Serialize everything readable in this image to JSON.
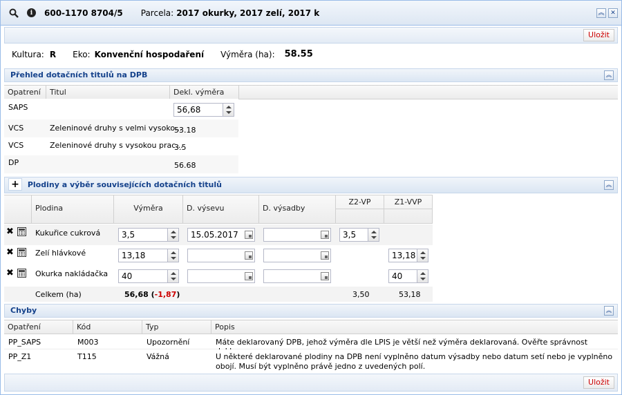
{
  "title": {
    "id": "600-1170 8704/5",
    "parcel_label": "Parcela:",
    "parcel_value": "2017 okurky, 2017 zelí, 2017 k"
  },
  "toolbar": {
    "save_label": "Uložit"
  },
  "info": {
    "culture_label": "Kultura:",
    "culture_value": "R",
    "eko_label": "Eko:",
    "eko_value": "Konvenční hospodaření",
    "area_label": "Výměra (ha):",
    "area_value": "58.55"
  },
  "overview": {
    "title": "Přehled dotačních titulů na DPB",
    "columns": [
      "Opatrení",
      "Titul",
      "Dekl. výměra"
    ],
    "rows": [
      {
        "measure": "SAPS",
        "title": "",
        "area": "56,68"
      },
      {
        "measure": "VCS",
        "title": "Zeleninové druhy s velmi vysoko...",
        "area": "53.18"
      },
      {
        "measure": "VCS",
        "title": "Zeleninové druhy s vysokou prac...",
        "area": "3.5"
      },
      {
        "measure": "DP",
        "title": "",
        "area": "56.68"
      }
    ]
  },
  "crops": {
    "title": "Plodiny a výběr souvisejících dotačních titulů",
    "columns": [
      "Plodina",
      "Výměra",
      "D. výsevu",
      "D. výsadby",
      "Z2-VP",
      "Z1-VVP"
    ],
    "rows": [
      {
        "crop": "Kukuřice cukrová",
        "area": "3,5",
        "sowing": "15.05.2017",
        "planting": "",
        "z2": "3,5",
        "z1": ""
      },
      {
        "crop": "Zelí hlávkové",
        "area": "13,18",
        "sowing": "",
        "planting": "",
        "z2": "",
        "z1": "13,18"
      },
      {
        "crop": "Okurka nakládačka",
        "area": "40",
        "sowing": "",
        "planting": "",
        "z2": "",
        "z1": "40"
      }
    ],
    "total": {
      "label": "Celkem (ha)",
      "area": "56,68",
      "diff": "-1,87",
      "z2": "3,50",
      "z1": "53,18"
    }
  },
  "errors": {
    "title": "Chyby",
    "columns": [
      "Opatření",
      "Kód",
      "Typ",
      "Popis"
    ],
    "rows": [
      {
        "measure": "PP_SAPS",
        "code": "M003",
        "type": "Upozornění",
        "desc": "Máte deklarovaný DPB, jehož výměra dle LPIS je větší než výměra deklarovaná. Ověřte správnost deklarace."
      },
      {
        "measure": "PP_Z1",
        "code": "T115",
        "type": "Vážná",
        "desc": "U některé deklarované plodiny na DPB není vyplněno datum výsadby nebo datum setí nebo je vyplněno obojí. Musí být vyplněno právě jedno z uvedených polí."
      }
    ]
  }
}
